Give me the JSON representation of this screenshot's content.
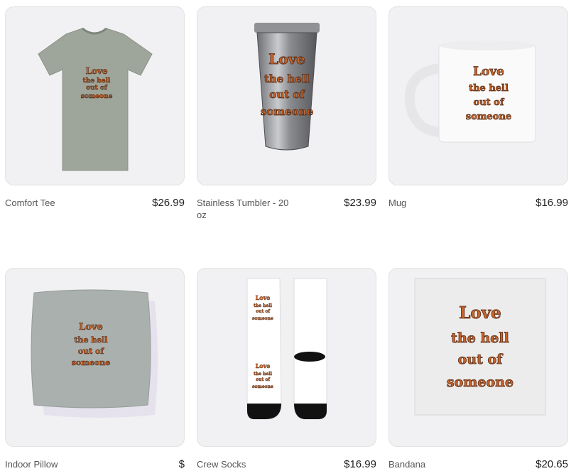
{
  "slogan": {
    "line1": "Love",
    "line2": "the hell",
    "line3": "out of",
    "line4": "someone"
  },
  "products": [
    {
      "name": "Comfort Tee",
      "price": "$26.99",
      "icon": "tshirt"
    },
    {
      "name": "Stainless Tumbler - 20 oz",
      "price": "$23.99",
      "icon": "tumbler"
    },
    {
      "name": "Mug",
      "price": "$16.99",
      "icon": "mug"
    },
    {
      "name": "Indoor Pillow",
      "price": "$",
      "icon": "pillow"
    },
    {
      "name": "Crew Socks",
      "price": "$16.99",
      "icon": "socks"
    },
    {
      "name": "Bandana",
      "price": "$20.65",
      "icon": "bandana"
    }
  ],
  "colors": {
    "slogan_fill": "#c8642a",
    "slogan_shadow": "#5a2a12",
    "tee": "#9ea59a",
    "pillow": "#a9b0ad"
  }
}
